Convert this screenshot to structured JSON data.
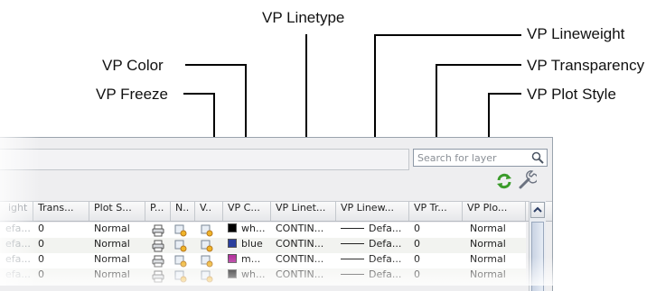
{
  "callouts": {
    "vp_linetype": "VP Linetype",
    "vp_lineweight": "VP Lineweight",
    "vp_color": "VP Color",
    "vp_transparency": "VP Transparency",
    "vp_freeze": "VP Freeze",
    "vp_plot_style": "VP Plot Style"
  },
  "search": {
    "placeholder": "Search for layer"
  },
  "icons": {
    "search": "search-icon",
    "refresh": "refresh-icon",
    "settings": "settings-icon"
  },
  "columns": [
    "ight",
    "Trans...",
    "Plot S...",
    "P...",
    "N..",
    "V..",
    "VP C...",
    "VP Linet...",
    "VP Linew...",
    "VP Tr...",
    "VP Plo..."
  ],
  "rows": [
    {
      "lineweight": "efa...",
      "transparency": "0",
      "plot_style": "Normal",
      "vp_color": "wh...",
      "vp_color_hex": "#000000",
      "vp_linetype": "CONTIN...",
      "vp_lineweight": "Defa...",
      "vp_transparency": "0",
      "vp_plot_style": "Normal"
    },
    {
      "lineweight": "efa...",
      "transparency": "0",
      "plot_style": "Normal",
      "vp_color": "blue",
      "vp_color_hex": "#2b3f9e",
      "vp_linetype": "CONTIN...",
      "vp_lineweight": "Defa...",
      "vp_transparency": "0",
      "vp_plot_style": "Normal"
    },
    {
      "lineweight": "efa...",
      "transparency": "0",
      "plot_style": "Normal",
      "vp_color": "m...",
      "vp_color_hex": "#b5369f",
      "vp_linetype": "CONTIN...",
      "vp_lineweight": "Defa...",
      "vp_transparency": "0",
      "vp_plot_style": "Normal"
    },
    {
      "lineweight": "efa...",
      "transparency": "0",
      "plot_style": "Normal",
      "vp_color": "wh...",
      "vp_color_hex": "#000000",
      "vp_linetype": "CONTIN...",
      "vp_lineweight": "Defa...",
      "vp_transparency": "0",
      "vp_plot_style": "Normal"
    }
  ],
  "colors": {
    "refresh_green": "#3a9b2a",
    "header_border": "#c4c8cd",
    "row_alt": "#f2f3f0"
  }
}
